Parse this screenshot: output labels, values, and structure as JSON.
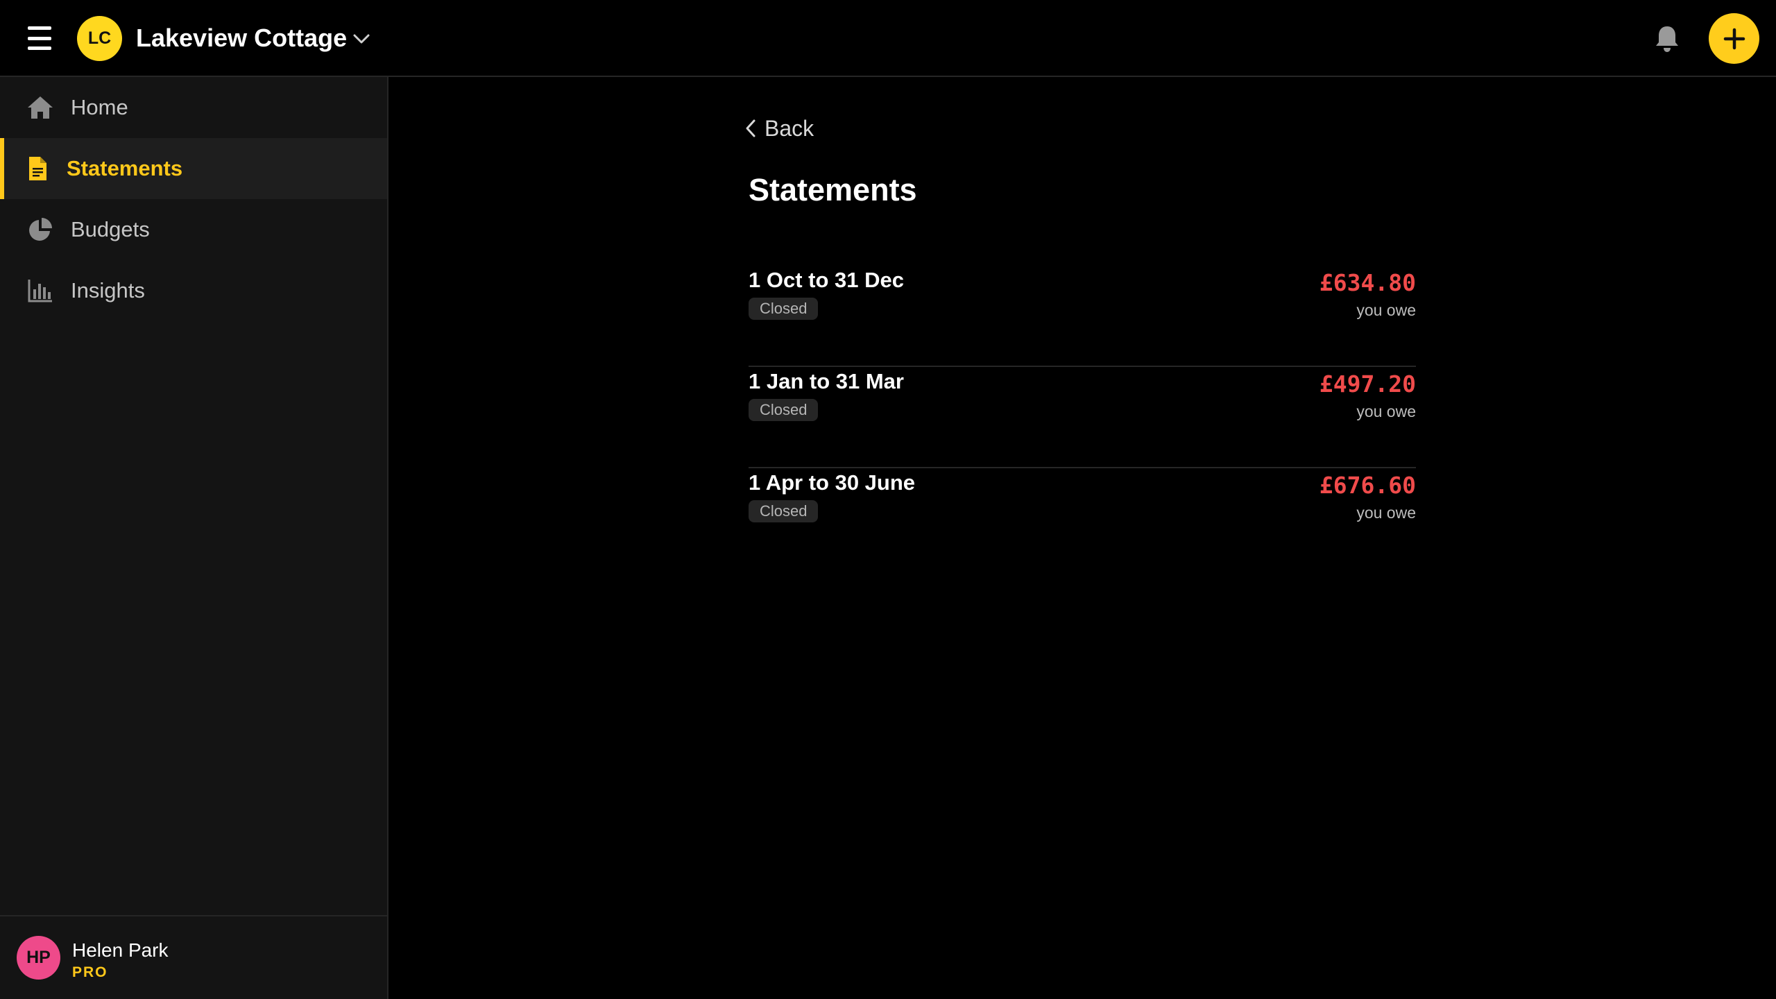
{
  "header": {
    "project_initials": "LC",
    "project_name": "Lakeview Cottage",
    "accent_color": "#ffcd1c"
  },
  "sidebar": {
    "items": [
      {
        "label": "Home",
        "icon": "home-icon"
      },
      {
        "label": "Statements",
        "icon": "document-icon",
        "active": true
      },
      {
        "label": "Budgets",
        "icon": "pie-chart-icon"
      },
      {
        "label": "Insights",
        "icon": "bar-chart-icon"
      }
    ],
    "user": {
      "initials": "HP",
      "name": "Helen Park",
      "plan": "PRO",
      "avatar_color": "#ee4a8a"
    }
  },
  "main": {
    "back_label": "Back",
    "title": "Statements",
    "statements": [
      {
        "period": "1 Oct to 31 Dec",
        "status": "Closed",
        "amount": "£634.80",
        "amount_label": "you owe"
      },
      {
        "period": "1 Jan to 31 Mar",
        "status": "Closed",
        "amount": "£497.20",
        "amount_label": "you owe"
      },
      {
        "period": "1 Apr to 30 June",
        "status": "Closed",
        "amount": "£676.60",
        "amount_label": "you owe"
      }
    ],
    "amount_color": "#f04b4b"
  }
}
